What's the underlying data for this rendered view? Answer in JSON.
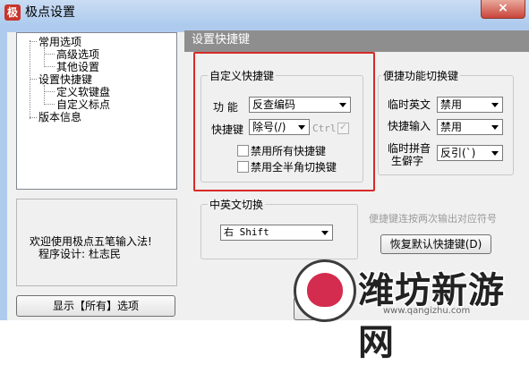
{
  "window": {
    "title": "极点设置",
    "app_icon": "极",
    "close_label": "×"
  },
  "tree": {
    "items": [
      {
        "label": "常用选项"
      },
      {
        "label": "高级选项"
      },
      {
        "label": "其他设置"
      },
      {
        "label": "设置快捷键"
      },
      {
        "label": "定义软键盘"
      },
      {
        "label": "自定义标点"
      },
      {
        "label": "版本信息"
      }
    ]
  },
  "welcome": {
    "line1": "欢迎使用极点五笔输入法!",
    "line2": "程序设计: 杜志民"
  },
  "show_all_button": "显示【所有】选项",
  "section": {
    "title": "设置快捷键"
  },
  "custom_shortcut": {
    "title": "自定义快捷键",
    "function_label": "功  能",
    "function_value": "反查编码",
    "shortcut_label": "快捷键",
    "shortcut_value": "除号(/)",
    "ctrl_label": "Ctrl",
    "ctrl_checked_mark": "✓",
    "disable_all_label": "禁用所有快捷键",
    "disable_fullhalf_label": "禁用全半角切换键"
  },
  "convenient_switch": {
    "title": "便捷功能切换键",
    "temp_english_label": "临时英文",
    "temp_english_value": "禁用",
    "quick_input_label": "快捷输入",
    "quick_input_value": "禁用",
    "temp_pinyin_label1": "临时拼音",
    "temp_pinyin_label2": "生僻字",
    "temp_pinyin_value": "反引(`)"
  },
  "cn_en_switch": {
    "title": "中英文切换",
    "value": "右 Shift"
  },
  "hint": "便捷键连按两次输出对应符号",
  "restore_button": "恢复默认快捷键(D)",
  "watermark": {
    "text": "潍坊新游网",
    "url": "www.qangizhu.com"
  }
}
